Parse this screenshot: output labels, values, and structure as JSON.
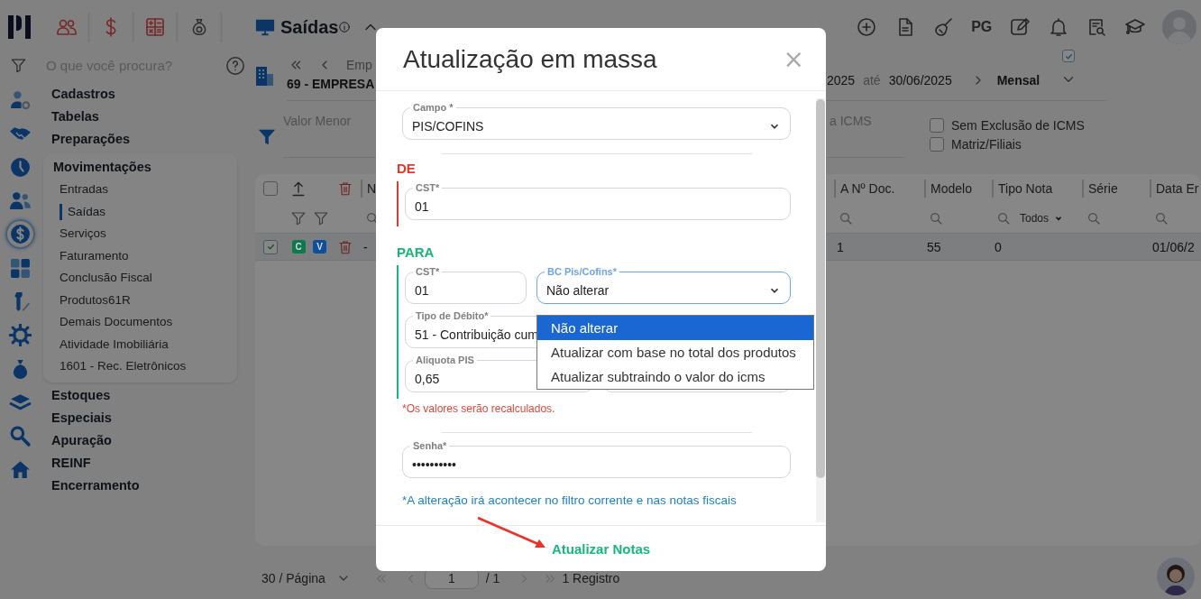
{
  "search": {
    "placeholder": "O que você procura?"
  },
  "rail": [
    {
      "selected": false
    },
    {
      "selected": false
    },
    {
      "selected": false
    },
    {
      "selected": false
    },
    {
      "selected": true
    },
    {
      "selected": false
    },
    {
      "selected": false
    },
    {
      "selected": false
    },
    {
      "selected": false
    },
    {
      "selected": false
    },
    {
      "selected": false
    },
    {
      "selected": false
    }
  ],
  "nav": [
    {
      "label": "Cadastros",
      "expanded": false
    },
    {
      "label": "Tabelas",
      "expanded": false
    },
    {
      "label": "Preparações",
      "expanded": false
    },
    {
      "label": "Movimentações",
      "expanded": true,
      "children": [
        {
          "label": "Entradas",
          "selected": false
        },
        {
          "label": "Saídas",
          "selected": true
        },
        {
          "label": "Serviços",
          "selected": false
        },
        {
          "label": "Faturamento",
          "selected": false
        },
        {
          "label": "Conclusão Fiscal",
          "selected": false
        },
        {
          "label": "Produtos61R",
          "selected": false
        },
        {
          "label": "Demais Documentos",
          "selected": false
        },
        {
          "label": "Atividade Imobiliária",
          "selected": false
        },
        {
          "label": "1601 - Rec. Eletrônicos",
          "selected": false
        }
      ]
    },
    {
      "label": "Estoques",
      "expanded": false
    },
    {
      "label": "Especiais",
      "expanded": false
    },
    {
      "label": "Apuração",
      "expanded": false
    },
    {
      "label": "REINF",
      "expanded": false
    },
    {
      "label": "Encerramento",
      "expanded": false
    }
  ],
  "page": {
    "title": "Saídas",
    "actions_label": "PG"
  },
  "company": {
    "nav_label": "Emp",
    "name": "69 - EMPRESA",
    "period_start": "2025",
    "period_sep": "até",
    "period_end": "30/06/2025",
    "period_type": "Mensal",
    "flag_checked": true
  },
  "filters": {
    "fields": [
      {
        "placeholder": "Valor Menor"
      },
      {
        "placeholder": "a ICMS"
      }
    ],
    "options": [
      {
        "label": "Sem Exclusão de ICMS",
        "checked": false
      },
      {
        "label": "Matriz/Filiais",
        "checked": false
      }
    ]
  },
  "table": {
    "select_all": false,
    "columns": [
      {
        "label": "N"
      },
      {
        "label": "A Nº Doc."
      },
      {
        "label": "Modelo"
      },
      {
        "label": "Tipo Nota",
        "filter_value": "Todos"
      },
      {
        "label": "Série"
      },
      {
        "label": "Data Er"
      }
    ],
    "rows": [
      {
        "checked": true,
        "badges": [
          {
            "text": "C",
            "color": "#0d7a4e"
          },
          {
            "text": "V",
            "color": "#0d4f99"
          }
        ],
        "cells": [
          "-",
          "1",
          "55",
          "0",
          null,
          "01/06/2"
        ]
      }
    ]
  },
  "pagination": {
    "page_size": "30 / Página",
    "page": "1",
    "total_pages": "/ 1",
    "records": "1 Registro"
  },
  "modal": {
    "title": "Atualização em massa",
    "close": "×",
    "campo": {
      "label": "Campo *",
      "value": "PIS/COFINS"
    },
    "sections": [
      {
        "heading": "DE",
        "kind": "from",
        "rows": [
          [
            {
              "kind": "input",
              "label": "CST*",
              "value": "01"
            }
          ]
        ]
      },
      {
        "heading": "PARA",
        "kind": "to",
        "rows": [
          [
            {
              "kind": "input",
              "label": "CST*",
              "value": "01"
            },
            {
              "kind": "select",
              "label": "BC Pis/Cofins*",
              "value": "Não alterar",
              "focused": true,
              "expanded": true,
              "options": [
                {
                  "label": "Não alterar",
                  "selected": true
                },
                {
                  "label": "Atualizar com base no total dos produtos",
                  "selected": false
                },
                {
                  "label": "Atualizar subtraindo o valor do icms",
                  "selected": false
                }
              ]
            }
          ],
          [
            {
              "kind": "input",
              "label": "Tipo de Débito*",
              "value": "51 - Contribuição cum"
            }
          ],
          [
            {
              "kind": "input",
              "label": "Aliquota PIS",
              "value": "0,65"
            },
            {
              "kind": "input"
            }
          ]
        ]
      }
    ],
    "note": "*Os valores serão recalculados.",
    "password": {
      "label": "Senha*",
      "value": "••••••••••"
    },
    "info": "*A alteração irá acontecer no filtro corrente e nas notas fiscais",
    "submit": "Atualizar Notas"
  }
}
